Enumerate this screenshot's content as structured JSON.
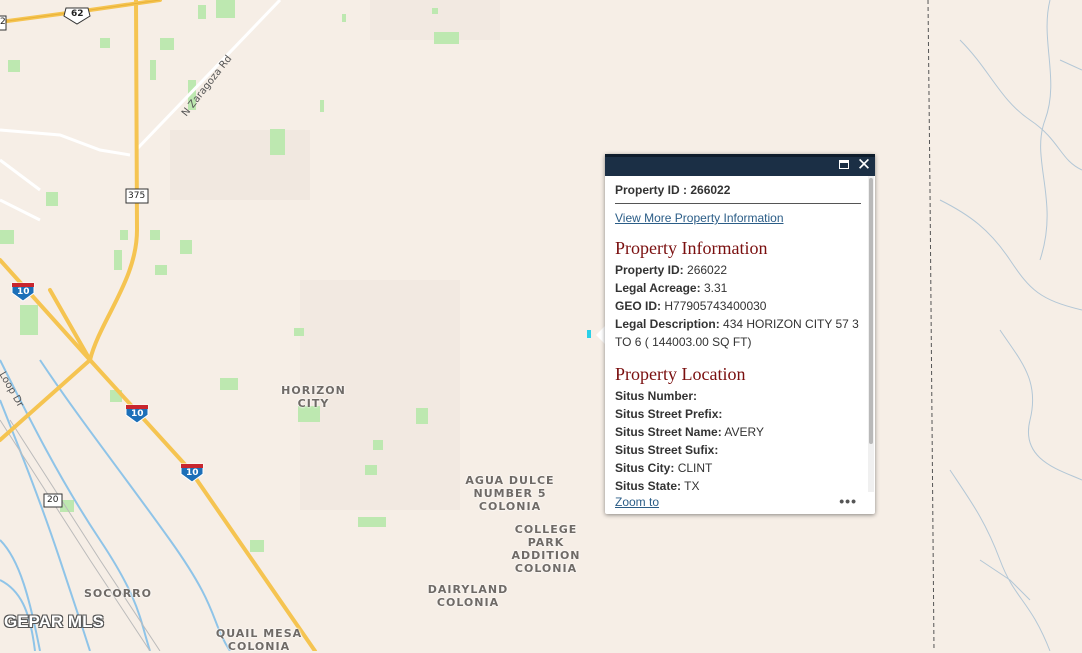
{
  "map": {
    "place_labels": [
      {
        "id": "horizon-city",
        "lines": [
          "HORIZON",
          "CITY"
        ]
      },
      {
        "id": "agua-dulce",
        "lines": [
          "AGUA DULCE",
          "NUMBER 5",
          "COLONIA"
        ]
      },
      {
        "id": "college-park",
        "lines": [
          "COLLEGE",
          "PARK",
          "ADDITION",
          "COLONIA"
        ]
      },
      {
        "id": "dairyland",
        "lines": [
          "DAIRYLAND",
          "COLONIA"
        ]
      },
      {
        "id": "socorro",
        "lines": [
          "SOCORRO"
        ]
      },
      {
        "id": "quail-mesa",
        "lines": [
          "QUAIL MESA",
          "COLONIA"
        ]
      }
    ],
    "road_labels": {
      "zaragoza": "N Zaragoza Rd",
      "loop": "Loop Dr"
    },
    "shields": {
      "us62": "62",
      "tx375": "375",
      "i10": "10",
      "fm20": "20",
      "edge": "2"
    },
    "watermark": "GEPAR MLS",
    "colors": {
      "background": "#f6eee6",
      "highway": "#f5c451",
      "park": "#bde8b0",
      "water": "#8fc4e8"
    }
  },
  "popup": {
    "property_id_label": "Property ID : 266022",
    "more_info_link": "View More Property Information",
    "info_title": "Property Information",
    "info_rows": [
      {
        "k": "Property ID:",
        "v": "266022"
      },
      {
        "k": "Legal Acreage:",
        "v": "3.31"
      },
      {
        "k": "GEO ID:",
        "v": "H77905743400030"
      },
      {
        "k": "Legal Description:",
        "v": "434 HORIZON CITY 57 3 TO 6 ( 144003.00 SQ FT)"
      }
    ],
    "location_title": "Property Location",
    "location_rows": [
      {
        "k": "Situs Number:",
        "v": ""
      },
      {
        "k": "Situs Street Prefix:",
        "v": ""
      },
      {
        "k": "Situs Street Name:",
        "v": "AVERY"
      },
      {
        "k": "Situs Street Sufix:",
        "v": ""
      },
      {
        "k": "Situs City:",
        "v": "CLINT"
      },
      {
        "k": "Situs State:",
        "v": "TX"
      }
    ],
    "zoom_to": "Zoom to",
    "more_actions": "•••",
    "close_glyph": "✕"
  }
}
